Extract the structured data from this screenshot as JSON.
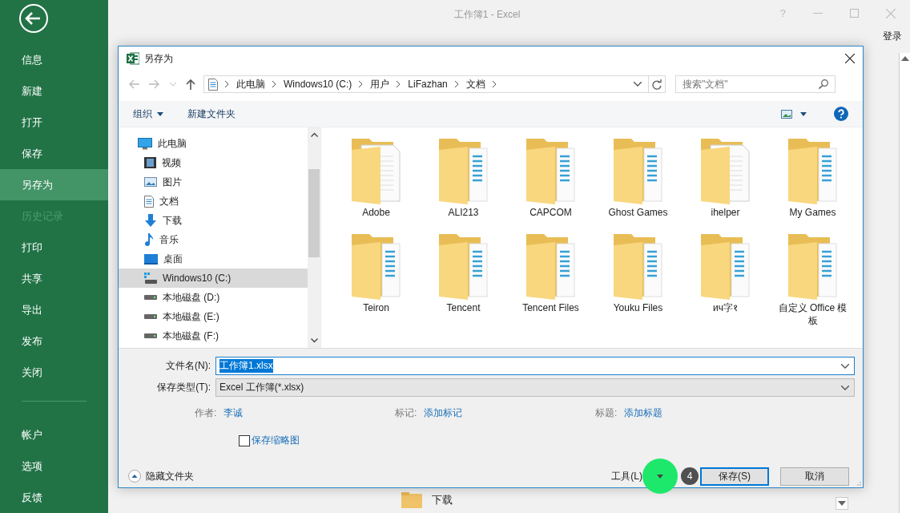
{
  "app": {
    "title": "工作簿1 - Excel",
    "help": "?",
    "sign_in": "登录"
  },
  "sidebar": {
    "items": [
      {
        "label": "信息",
        "selected": false,
        "disabled": false
      },
      {
        "label": "新建",
        "selected": false,
        "disabled": false
      },
      {
        "label": "打开",
        "selected": false,
        "disabled": false
      },
      {
        "label": "保存",
        "selected": false,
        "disabled": false
      },
      {
        "label": "另存为",
        "selected": true,
        "disabled": false
      },
      {
        "label": "历史记录",
        "selected": false,
        "disabled": true
      },
      {
        "label": "打印",
        "selected": false,
        "disabled": false
      },
      {
        "label": "共享",
        "selected": false,
        "disabled": false
      },
      {
        "label": "导出",
        "selected": false,
        "disabled": false
      },
      {
        "label": "发布",
        "selected": false,
        "disabled": false
      },
      {
        "label": "关闭",
        "selected": false,
        "disabled": false
      }
    ],
    "bottom_items": [
      "帐户",
      "选项",
      "反馈"
    ]
  },
  "dialog": {
    "title": "另存为",
    "breadcrumb": [
      "此电脑",
      "Windows10 (C:)",
      "用户",
      "LiFazhan",
      "文档"
    ],
    "search": {
      "placeholder": "搜索\"文档\""
    },
    "toolbar": {
      "organize": "组织",
      "new_folder": "新建文件夹"
    },
    "nav": [
      {
        "label": "此电脑",
        "kind": "pc",
        "selected": false,
        "children": [
          {
            "label": "视频",
            "kind": "video",
            "selected": false
          },
          {
            "label": "图片",
            "kind": "pictures",
            "selected": false
          },
          {
            "label": "文档",
            "kind": "documents",
            "selected": false
          },
          {
            "label": "下载",
            "kind": "downloads",
            "selected": false
          },
          {
            "label": "音乐",
            "kind": "music",
            "selected": false
          },
          {
            "label": "桌面",
            "kind": "desktop",
            "selected": false
          },
          {
            "label": "Windows10 (C:)",
            "kind": "system-drive",
            "selected": true
          },
          {
            "label": "本地磁盘 (D:)",
            "kind": "drive",
            "selected": false
          },
          {
            "label": "本地磁盘 (E:)",
            "kind": "drive",
            "selected": false
          },
          {
            "label": "本地磁盘 (F:)",
            "kind": "drive",
            "selected": false
          }
        ]
      }
    ],
    "folders": [
      {
        "name": "Adobe",
        "kind": "paper"
      },
      {
        "name": "ALI213",
        "kind": "striped"
      },
      {
        "name": "CAPCOM",
        "kind": "striped"
      },
      {
        "name": "Ghost Games",
        "kind": "striped"
      },
      {
        "name": "ihelper",
        "kind": "paper"
      },
      {
        "name": "My Games",
        "kind": "striped"
      },
      {
        "name": "Teiron",
        "kind": "striped"
      },
      {
        "name": "Tencent",
        "kind": "striped"
      },
      {
        "name": "Tencent Files",
        "kind": "striped"
      },
      {
        "name": "Youku Files",
        "kind": "striped"
      },
      {
        "name": "ич字१",
        "kind": "striped"
      },
      {
        "name": "自定义 Office 模板",
        "kind": "striped"
      }
    ],
    "filename": {
      "label": "文件名(N):",
      "value": "工作簿1.xlsx",
      "selected": true
    },
    "filetype": {
      "label": "保存类型(T):",
      "value": "Excel 工作簿(*.xlsx)"
    },
    "meta": [
      {
        "label": "作者:",
        "value": "李诚"
      },
      {
        "label": "标记:",
        "value": "添加标记"
      },
      {
        "label": "标题:",
        "value": "添加标题"
      }
    ],
    "thumbnail": {
      "label": "保存缩略图",
      "checked": false
    },
    "hide_folders": "隐藏文件夹",
    "tools": "工具(L)",
    "save": "保存(S)",
    "cancel": "取消",
    "step": "4"
  },
  "background_item": "下载"
}
